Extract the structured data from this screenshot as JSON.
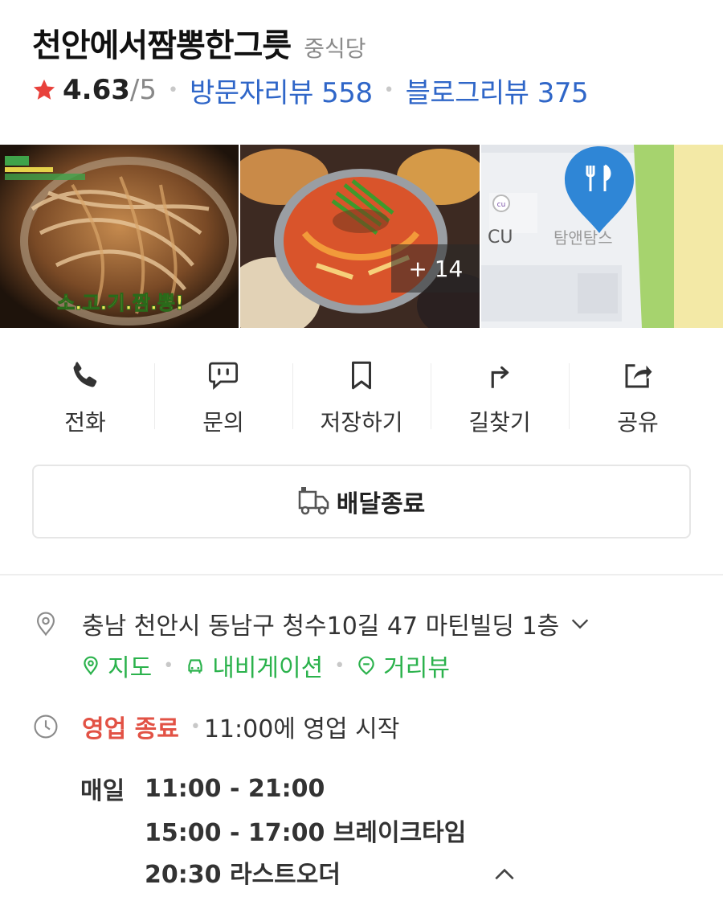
{
  "header": {
    "title": "천안에서짬뽕한그릇",
    "category": "중식당",
    "rating": "4.63",
    "rating_max": "/5",
    "visitor_reviews": "방문자리뷰 558",
    "blog_reviews": "블로그리뷰 375"
  },
  "photos": {
    "photo1_caption": "소.고.기.짬.뽕!",
    "more_count": "+ 14",
    "map_store_label": "CU",
    "map_place_label": "탐앤탐스"
  },
  "actions": [
    {
      "label": "전화",
      "icon": "phone-icon"
    },
    {
      "label": "문의",
      "icon": "chat-icon"
    },
    {
      "label": "저장하기",
      "icon": "bookmark-icon"
    },
    {
      "label": "길찾기",
      "icon": "directions-icon"
    },
    {
      "label": "공유",
      "icon": "share-icon"
    }
  ],
  "delivery": {
    "label": "배달종료"
  },
  "address": {
    "text": "충남 천안시 동남구 청수10길 47 마틴빌딩 1층",
    "links": {
      "map": "지도",
      "navigation": "내비게이션",
      "street_view": "거리뷰"
    }
  },
  "hours": {
    "status": "영업 종료",
    "next_open": "11:00에 영업 시작",
    "day": "매일",
    "time_main": "11:00 - 21:00",
    "break_time": "15:00 - 17:00 브레이크타임",
    "last_order": "20:30 라스트오더"
  },
  "colors": {
    "accent_blue": "#2f66c8",
    "link_green": "#2bb24c",
    "closed_red": "#e25245",
    "star_red": "#e8413b",
    "pin_blue": "#2f86d6"
  }
}
